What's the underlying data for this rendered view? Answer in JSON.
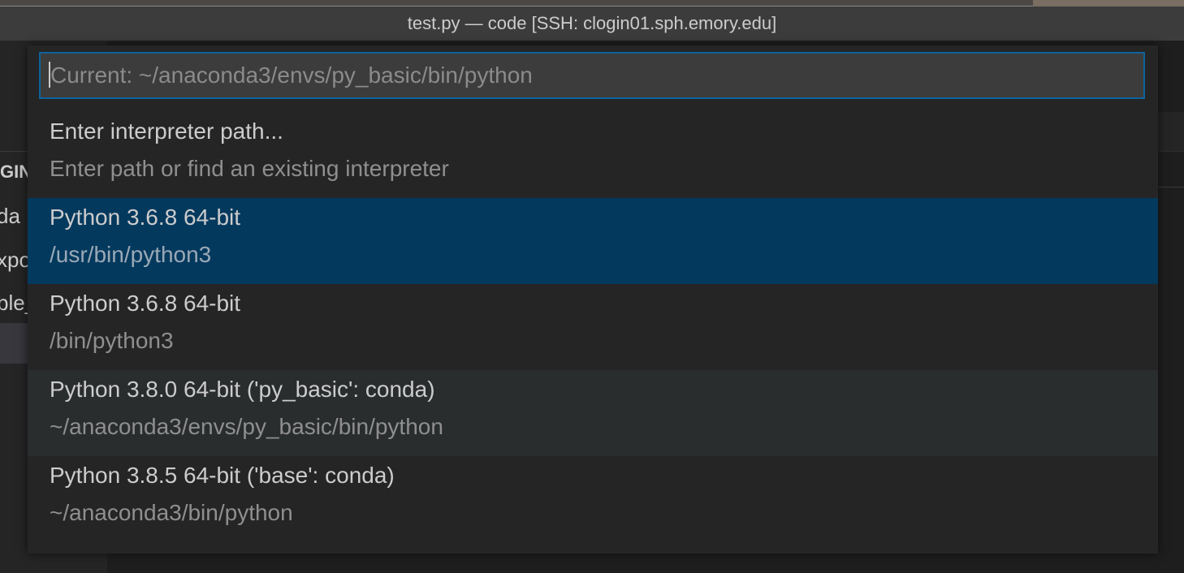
{
  "window": {
    "title": "test.py — code [SSH: clogin01.sph.emory.edu]"
  },
  "sidebar": {
    "header_fragment": "GIN",
    "items": [
      "da",
      "xpo",
      "ble_"
    ]
  },
  "quick_pick": {
    "placeholder": "Current: ~/anaconda3/envs/py_basic/bin/python",
    "items": [
      {
        "label": "Enter interpreter path...",
        "description": "Enter path or find an existing interpreter",
        "state": "normal"
      },
      {
        "label": "Python 3.6.8 64-bit",
        "description": "/usr/bin/python3",
        "state": "selected"
      },
      {
        "label": "Python 3.6.8 64-bit",
        "description": "/bin/python3",
        "state": "normal"
      },
      {
        "label": "Python 3.8.0 64-bit ('py_basic': conda)",
        "description": "~/anaconda3/envs/py_basic/bin/python",
        "state": "hover"
      },
      {
        "label": "Python 3.8.5 64-bit ('base': conda)",
        "description": "~/anaconda3/bin/python",
        "state": "normal"
      }
    ]
  },
  "colors": {
    "accent_border": "#0e639c",
    "selected_row": "#04395e",
    "hover_row": "#2a2d2e",
    "titlebar": "#3c3c3c",
    "panel": "#252526"
  }
}
